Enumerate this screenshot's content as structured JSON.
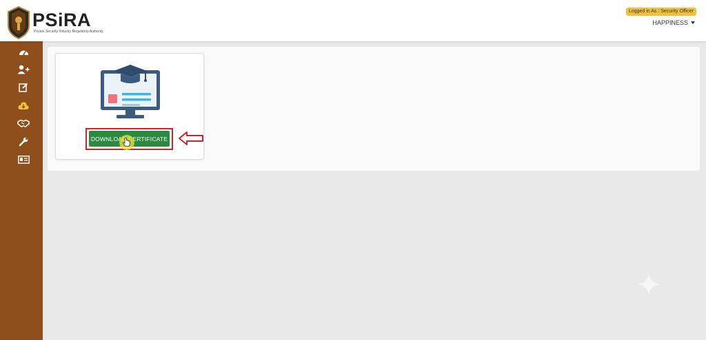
{
  "brand": {
    "name": "PSiRA",
    "tagline": "Private Security Industry Regulatory Authority"
  },
  "header": {
    "role_badge": "Logged in As : Security Officer",
    "user_name": "HAPPINESS"
  },
  "sidebar": {
    "items": [
      {
        "icon": "dashboard-icon"
      },
      {
        "icon": "add-user-icon"
      },
      {
        "icon": "edit-icon"
      },
      {
        "icon": "cloud-download-icon"
      },
      {
        "icon": "handshake-icon"
      },
      {
        "icon": "wrench-icon"
      },
      {
        "icon": "id-card-icon"
      }
    ]
  },
  "main": {
    "download_button": "DOWNLOAD CERTIFICATE"
  },
  "colors": {
    "sidebar": "#8f4f1c",
    "button": "#2b8a3e",
    "annotation": "#c6282d",
    "badge": "#f0c23b"
  }
}
